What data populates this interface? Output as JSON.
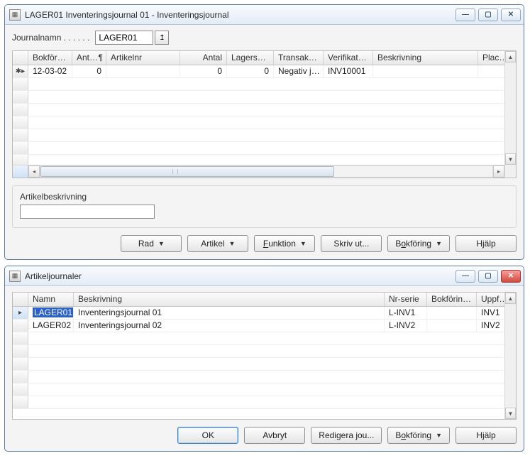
{
  "window1": {
    "title": "LAGER01 Inventeringsjournal 01 - Inventeringsjournal",
    "form": {
      "journalname_label": "Journalnamn . . . . . .",
      "journalname_value": "LAGER01"
    },
    "columns": [
      "Bokföri…",
      "Ant…",
      "Artikelnr",
      "Antal",
      "Lagersald…",
      "Transaktio…",
      "Verifikatio…",
      "Beskrivning",
      "Placerin"
    ],
    "col2_pilcrow": "¶",
    "row": {
      "c0": "12-03-02",
      "c1": "0",
      "c2": "",
      "c3": "0",
      "c4": "0",
      "c5": "Negativ j…",
      "c6": "INV10001",
      "c7": "",
      "c8": ""
    },
    "group_label": "Artikelbeskrivning",
    "buttons": {
      "rad": "Rad",
      "artikel": "Artikel",
      "funktion": "Funktion",
      "skrivut": "Skriv ut...",
      "bokforing": "Bokföring",
      "hjalp": "Hjälp"
    }
  },
  "window2": {
    "title": "Artikeljournaler",
    "columns": [
      "Namn",
      "Beskrivning",
      "Nr-serie",
      "Bokföring…",
      "Uppföljni…"
    ],
    "rows": [
      {
        "namn": "LAGER01",
        "beskr": "Inventeringsjournal 01",
        "nr": "L-INV1",
        "bok": "",
        "upp": "INV1"
      },
      {
        "namn": "LAGER02",
        "beskr": "Inventeringsjournal 02",
        "nr": "L-INV2",
        "bok": "",
        "upp": "INV2"
      }
    ],
    "buttons": {
      "ok": "OK",
      "avbryt": "Avbryt",
      "redigera": "Redigera jou...",
      "bokforing": "Bokföring",
      "hjalp": "Hjälp"
    }
  }
}
